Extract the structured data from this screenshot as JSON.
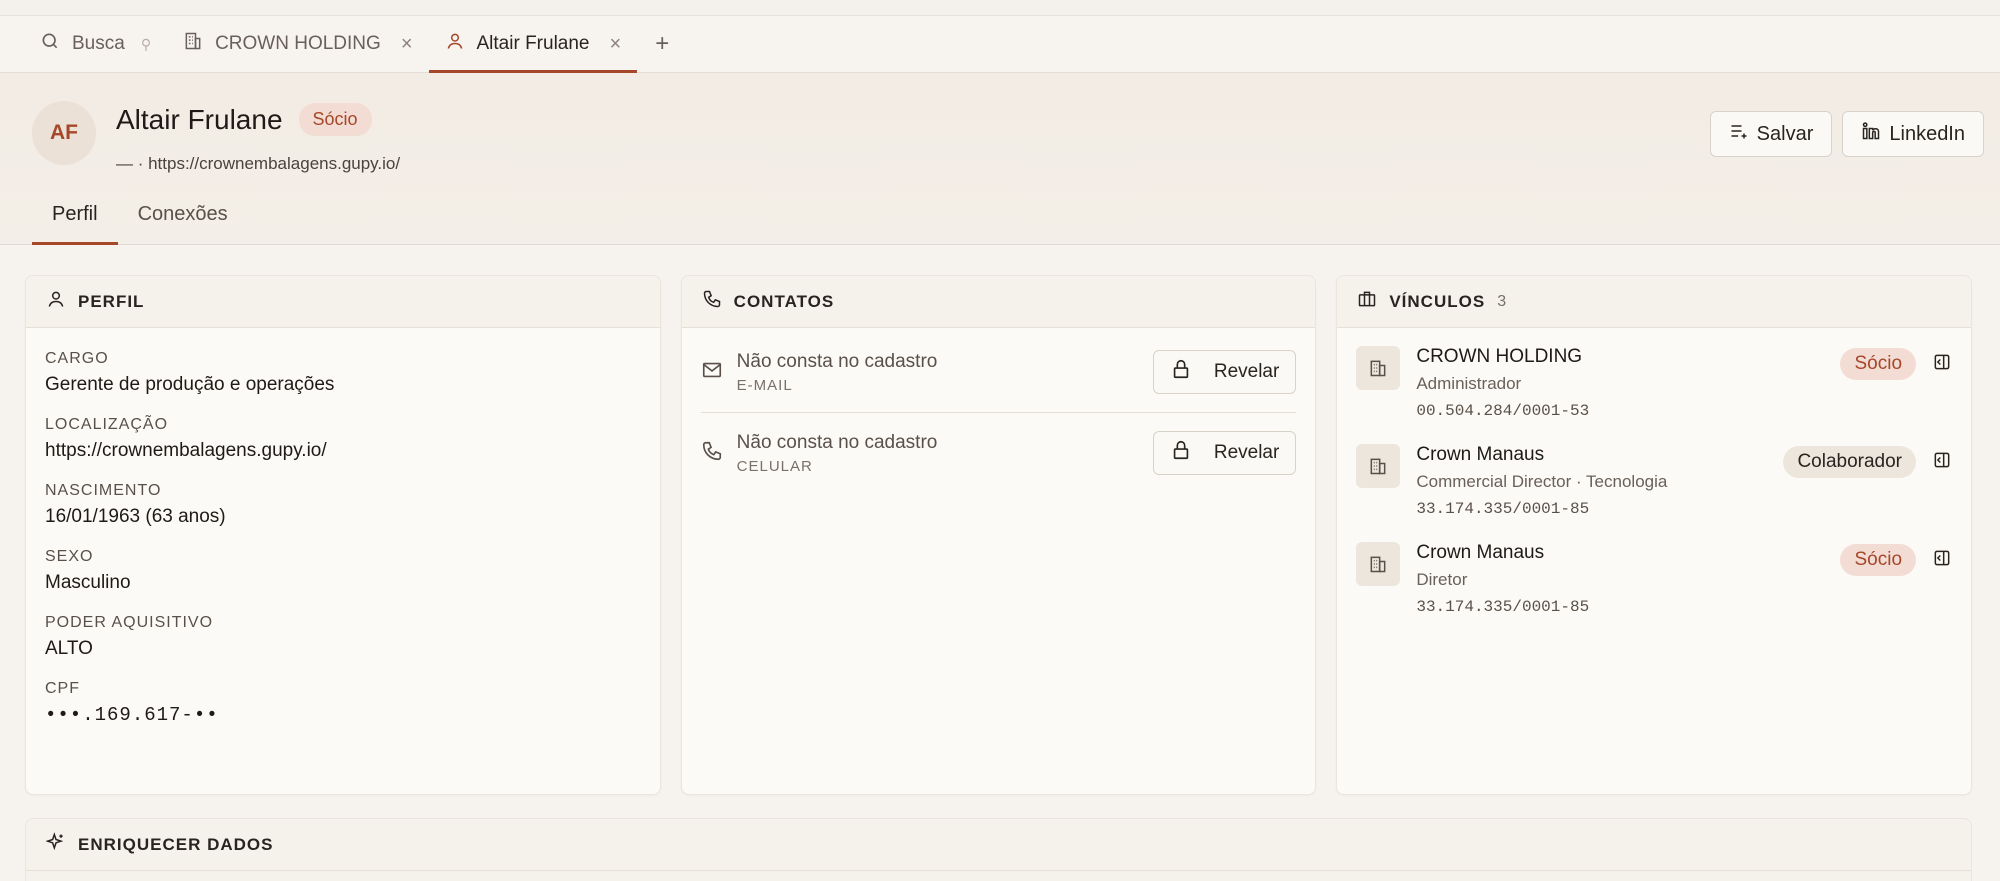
{
  "tabs": [
    {
      "label": "Busca",
      "icon": "search-icon"
    },
    {
      "label": "CROWN HOLDING",
      "icon": "building-icon"
    },
    {
      "label": "Altair Frulane",
      "icon": "user-icon"
    }
  ],
  "header": {
    "initials": "AF",
    "name": "Altair Frulane",
    "badge": "Sócio",
    "subtitle": "— · https://crownembalagens.gupy.io/",
    "save_label": "Salvar",
    "linkedin_label": "LinkedIn",
    "subtabs": [
      "Perfil",
      "Conexões"
    ]
  },
  "perfil": {
    "title": "PERFIL",
    "fields": [
      {
        "label": "CARGO",
        "value": "Gerente de produção e operações"
      },
      {
        "label": "LOCALIZAÇÃO",
        "value": "https://crownembalagens.gupy.io/"
      },
      {
        "label": "NASCIMENTO",
        "value": "16/01/1963 (63 anos)"
      },
      {
        "label": "SEXO",
        "value": "Masculino"
      },
      {
        "label": "PODER AQUISITIVO",
        "value": "ALTO"
      },
      {
        "label": "CPF",
        "value": "•••.169.617-••"
      }
    ]
  },
  "contatos": {
    "title": "CONTATOS",
    "items": [
      {
        "main": "Não consta no cadastro",
        "sub": "E-MAIL",
        "button": "Revelar"
      },
      {
        "main": "Não consta no cadastro",
        "sub": "CELULAR",
        "button": "Revelar"
      }
    ]
  },
  "vinculos": {
    "title": "VÍNCULOS",
    "count": "3",
    "items": [
      {
        "name": "CROWN HOLDING",
        "role": "Administrador",
        "cnpj": "00.504.284/0001-53",
        "tag": "Sócio"
      },
      {
        "name": "Crown Manaus",
        "role": "Commercial Director · Tecnologia",
        "cnpj": "33.174.335/0001-85",
        "tag": "Colaborador"
      },
      {
        "name": "Crown Manaus",
        "role": "Diretor",
        "cnpj": "33.174.335/0001-85",
        "tag": "Sócio"
      }
    ]
  },
  "enriquecer": {
    "title": "ENRIQUECER DADOS"
  },
  "colors": {
    "accent": "#a5482a",
    "background": "#f6f3ee",
    "card": "#fcfaf6"
  }
}
